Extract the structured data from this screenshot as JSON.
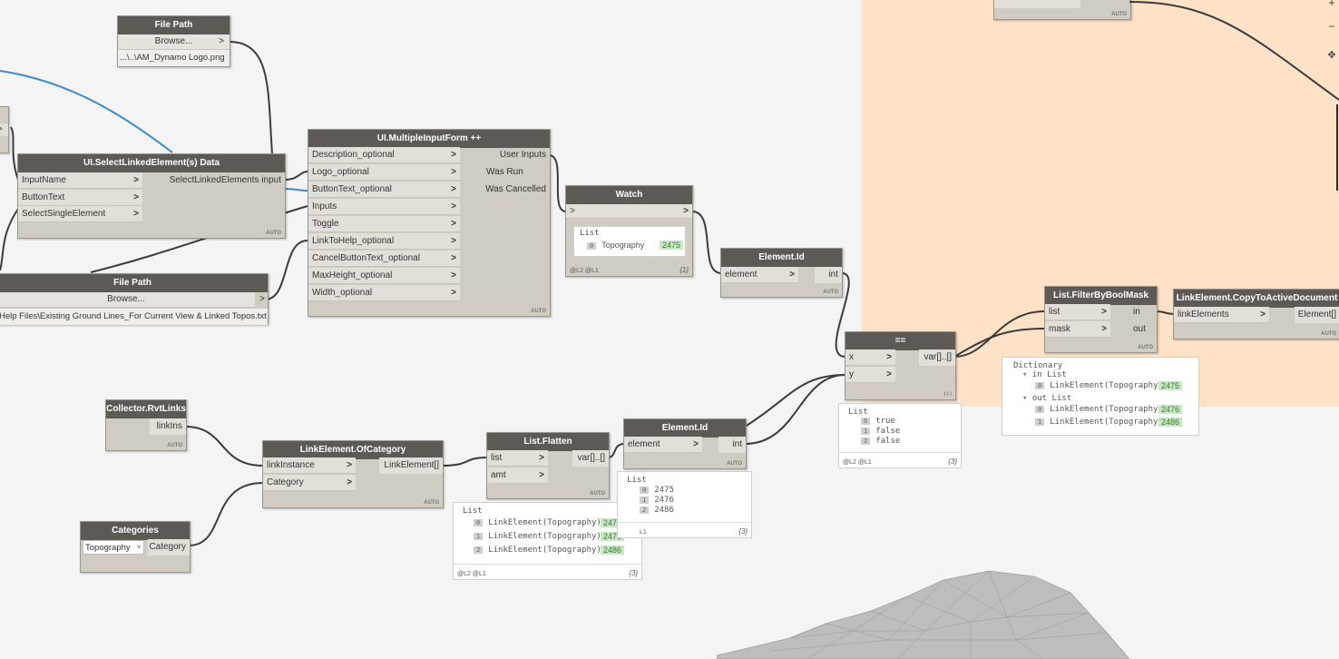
{
  "colors": {
    "canvas": "#f4f4f4",
    "group": "#fde2c8",
    "node_header": "#5d5955",
    "node_body": "#d0ccc3",
    "wire": "#3b3b3b",
    "wire_highlight": "#3a8ad0",
    "watch_value": "#c8e8c4"
  },
  "file_path_top": {
    "title": "File Path",
    "browse": "Browse...",
    "arrow": ">",
    "path": "...\\..\\AM_Dynamo Logo.png"
  },
  "file_path_bottom": {
    "title": "File Path",
    "browse": "Browse...",
    "arrow": ">",
    "path": "Help Files\\Existing Ground Lines_For Current View & Linked Topos.txt"
  },
  "select_linked": {
    "title": "UI.SelectLinkedElement(s) Data",
    "inputs": [
      "InputName",
      "ButtonText",
      "SelectSingleElement"
    ],
    "output": "SelectLinkedElements input",
    "lacing": "AUTO"
  },
  "multi_form": {
    "title": "UI.MultipleInputForm ++",
    "inputs": [
      "Description_optional",
      "Logo_optional",
      "ButtonText_optional",
      "Inputs",
      "Toggle",
      "LinkToHelp_optional",
      "CancelButtonText_optional",
      "MaxHeight_optional",
      "Width_optional"
    ],
    "outputs": [
      "User Inputs",
      "Was Run",
      "Was Cancelled"
    ],
    "lacing": "AUTO"
  },
  "watch": {
    "title": "Watch",
    "in": ">",
    "out": ">",
    "list_label": "List",
    "index": "0",
    "item": "Topography",
    "value": "2475",
    "levels": "@L2 @L1",
    "count": "{1}"
  },
  "element_id_top": {
    "title": "Element.Id",
    "input": "element",
    "output": "int",
    "lacing": "AUTO"
  },
  "equals": {
    "title": "==",
    "inputs": [
      "x",
      "y"
    ],
    "output": "var[]..[]",
    "lacing": "l l \\"
  },
  "equals_preview": {
    "list_label": "List",
    "items": [
      [
        "0",
        "true"
      ],
      [
        "1",
        "false"
      ],
      [
        "2",
        "false"
      ]
    ],
    "levels": "@L2 @L1",
    "count": "{3}"
  },
  "filter": {
    "title": "List.FilterByBoolMask",
    "inputs": [
      "list",
      "mask"
    ],
    "outputs": [
      "in",
      "out"
    ],
    "lacing": "AUTO"
  },
  "filter_preview": {
    "dict_label": "Dictionary",
    "in_label": "in",
    "out_label": "out",
    "list_label": "List",
    "in_items": [
      [
        "0",
        "LinkElement(Topography)",
        "2475"
      ]
    ],
    "out_items": [
      [
        "0",
        "LinkElement(Topography)",
        "2476"
      ],
      [
        "1",
        "LinkElement(Topography)",
        "2486"
      ]
    ]
  },
  "copy": {
    "title": "LinkElement.CopyToActiveDocument",
    "input": "linkElements",
    "output": "Element[]",
    "lacing": "AUTO"
  },
  "collector": {
    "title": "Collector.RvtLinks",
    "output": "linkIns",
    "lacing": "AUTO"
  },
  "of_category": {
    "title": "LinkElement.OfCategory",
    "inputs": [
      "linkInstance",
      "Category"
    ],
    "output": "LinkElement[]",
    "lacing": "AUTO"
  },
  "flatten": {
    "title": "List.Flatten",
    "inputs": [
      "list",
      "amt"
    ],
    "output": "var[]..[]",
    "lacing": "AUTO"
  },
  "flatten_preview": {
    "list_label": "List",
    "items": [
      [
        "0",
        "LinkElement(Topography)",
        "2475"
      ],
      [
        "1",
        "LinkElement(Topography)",
        "2476"
      ],
      [
        "2",
        "LinkElement(Topography)",
        "2486"
      ]
    ],
    "levels": "@L2 @L1",
    "count": "{3}"
  },
  "element_id_bottom": {
    "title": "Element.Id",
    "input": "element",
    "output": "int",
    "lacing": "AUTO"
  },
  "id_preview": {
    "list_label": "List",
    "items": [
      [
        "0",
        "2475"
      ],
      [
        "1",
        "2476"
      ],
      [
        "2",
        "2486"
      ]
    ],
    "levels": "L1",
    "count": "{3}"
  },
  "categories": {
    "title": "Categories",
    "selected": "Topography",
    "output": "Category"
  },
  "top_partial": {
    "lacing": "AUTO"
  },
  "left_partial": {
    "arrow": ">"
  },
  "zoom": {
    "plus": "+",
    "minus": "−"
  }
}
